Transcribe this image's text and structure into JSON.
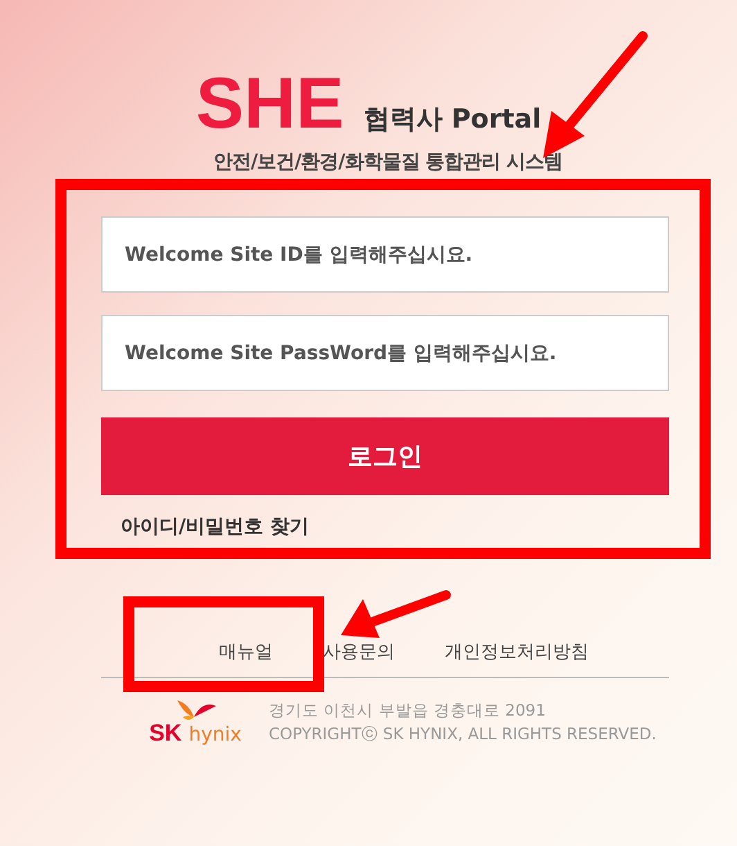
{
  "header": {
    "logo": "SHE",
    "title": "협력사 Portal",
    "subtitle": "안전/보건/환경/화학물질 통합관리 시스템"
  },
  "login": {
    "id_field": {
      "placeholder": "Welcome Site ID를 입력해주십시요."
    },
    "password_field": {
      "placeholder": "Welcome Site PassWord를 입력해주십시요."
    },
    "button": "로그인",
    "find_link": "아이디/비밀번호 찾기"
  },
  "footer": {
    "links": [
      "매뉴얼",
      "사용문의",
      "개인정보처리방침"
    ],
    "brand": {
      "mark": "SK",
      "name": "hynix"
    },
    "address": "경기도 이천시 부발읍 경충대로 2091",
    "copyright": "COPYRIGHTⓒ SK HYNIX, ALL RIGHTS RESERVED."
  }
}
